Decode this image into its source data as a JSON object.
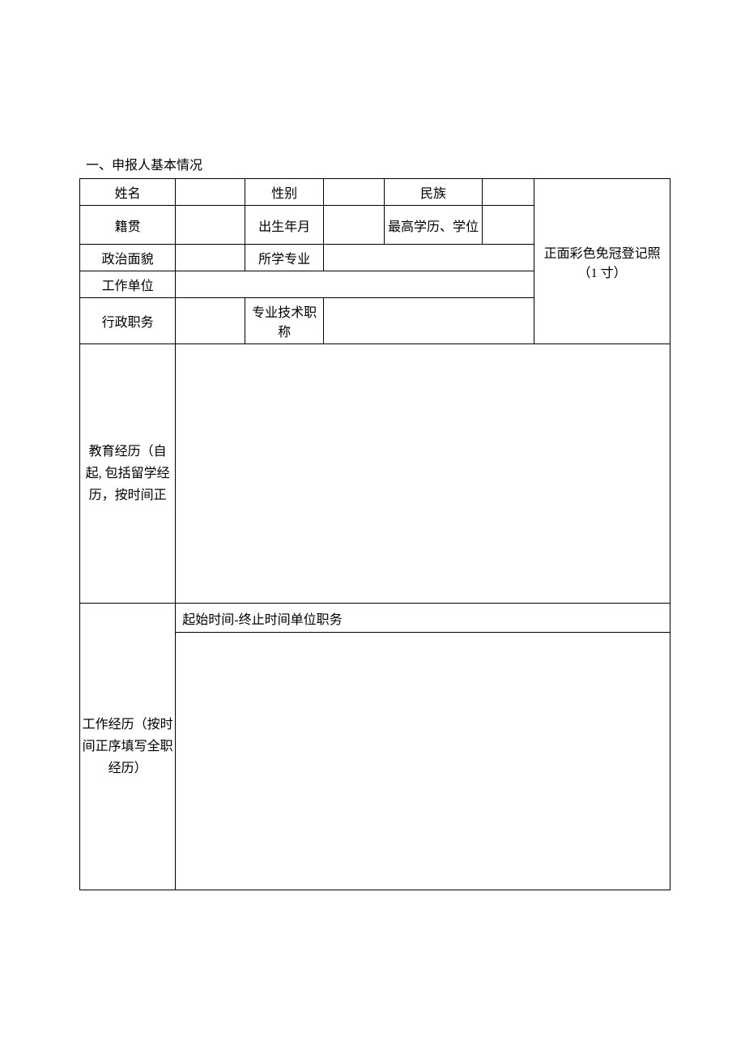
{
  "section_title": "一、申报人基本情况",
  "labels": {
    "name": "姓名",
    "gender": "性别",
    "ethnicity": "民族",
    "native_place": "籍贯",
    "birth_date": "出生年月",
    "education_degree": "最高学历、学位",
    "political_status": "政治面貌",
    "major": "所学专业",
    "work_unit": "工作单位",
    "admin_position": "行政职务",
    "professional_title": "专业技术职称",
    "photo": "正面彩色免冠登记照（1 寸）",
    "education_history": "教育经历（自　　起, 包括留学经历，按时间正",
    "work_history_label": "工作经历（按时间正序填写全职经历）",
    "work_history_header": "起始时间-终止时间单位职务"
  },
  "values": {
    "name": "",
    "gender": "",
    "ethnicity": "",
    "native_place": "",
    "birth_date": "",
    "education_degree": "",
    "political_status": "",
    "major": "",
    "work_unit": "",
    "admin_position": "",
    "professional_title": "",
    "education_history": "",
    "work_history_body": ""
  }
}
